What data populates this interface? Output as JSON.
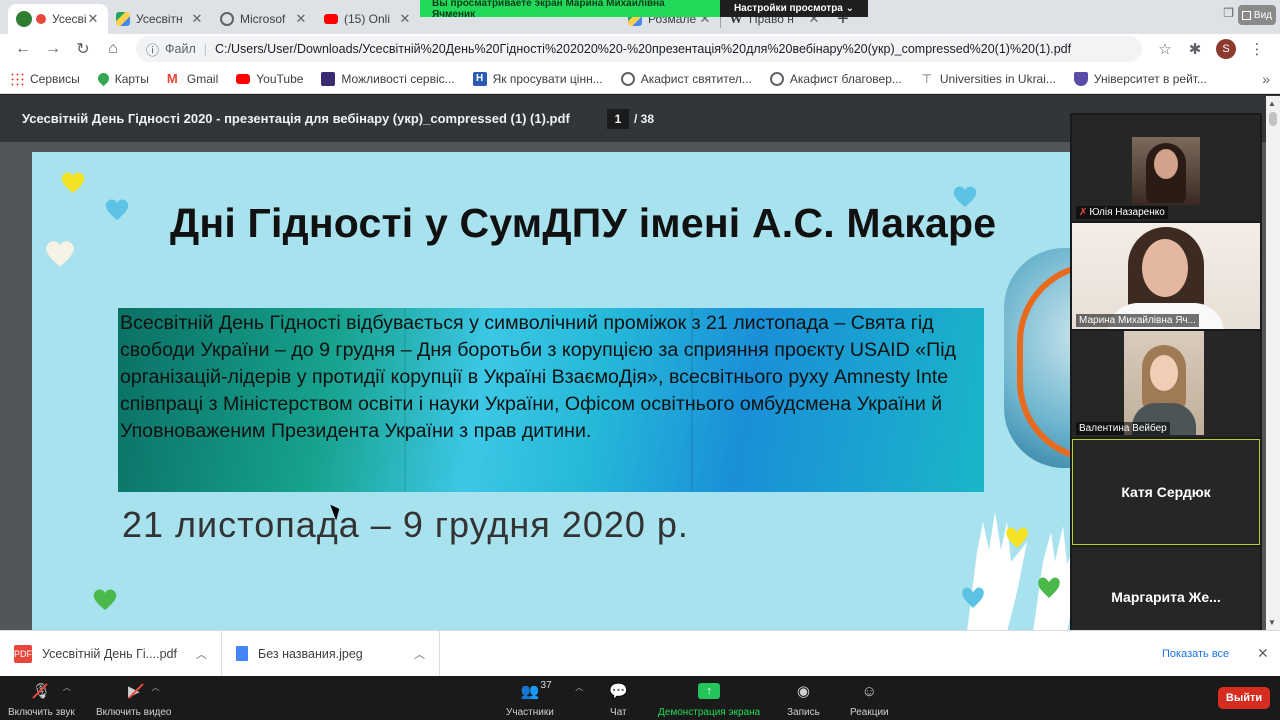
{
  "browser": {
    "tabs": [
      {
        "label": "Усесвіт",
        "icon": "pdf-icon",
        "color": "#e8453c",
        "active": true
      },
      {
        "label": "Усесвітн",
        "icon": "drive-icon",
        "color": "#1fa463"
      },
      {
        "label": "Microsof",
        "icon": "globe-icon",
        "color": "#5f6368"
      },
      {
        "label": "(15) Onli",
        "icon": "youtube-icon",
        "color": "#ff0000"
      },
      {
        "label": "",
        "icon": "youtube-icon",
        "color": "#ff0000"
      },
      {
        "label": "",
        "icon": "youtube-icon",
        "color": "#ff0000"
      },
      {
        "label": "",
        "icon": "youtube-icon",
        "color": "#ff0000"
      },
      {
        "label": "",
        "icon": "youtube-icon",
        "color": "#ff0000"
      },
      {
        "label": "Розмале",
        "icon": "drive-icon",
        "color": "#1fa463"
      },
      {
        "label": "Право н",
        "icon": "wikipedia-icon",
        "color": "#333333"
      }
    ],
    "url_scheme_label": "Файл",
    "url": "C:/Users/User/Downloads/Усесвітній%20День%20Гідності%202020%20-%20презентація%20для%20вебінару%20(укр)_compressed%20(1)%20(1).pdf",
    "profile_initial": "S",
    "bookmarks": [
      {
        "label": "Сервисы",
        "icon": "apps-icon",
        "color": "#ea4335"
      },
      {
        "label": "Карты",
        "icon": "maps-icon",
        "color": "#34a853"
      },
      {
        "label": "Gmail",
        "icon": "gmail-icon",
        "color": "#ea4335"
      },
      {
        "label": "YouTube",
        "icon": "youtube-icon",
        "color": "#ff0000"
      },
      {
        "label": "Можливості сервіс...",
        "icon": "bookmark-icon",
        "color": "#3b2b6e"
      },
      {
        "label": "Як просувати цінн...",
        "icon": "bookmark-icon",
        "color": "#2a5db0"
      },
      {
        "label": "Акафист святител...",
        "icon": "globe-icon",
        "color": "#5f6368"
      },
      {
        "label": "Акафист благовер...",
        "icon": "globe-icon",
        "color": "#5f6368"
      },
      {
        "label": "Universities in Ukrai...",
        "icon": "university-icon",
        "color": "#5f6368"
      },
      {
        "label": "Університет в рейт...",
        "icon": "shield-icon",
        "color": "#5b4aa8"
      }
    ]
  },
  "zoom_share": {
    "banner": "Вы просматриваете экран Марина Михайлівна Ячменик",
    "options": "Настройки просмотра ⌄",
    "view_button": "Вид"
  },
  "pdf": {
    "title": "Усесвітній День Гідності 2020 - презентація для вебінару (укр)_compressed (1) (1).pdf",
    "current_page": "1",
    "total_pages": "/ 38"
  },
  "slide": {
    "title": "Дні Гідності у СумДПУ імені А.С. Макаре",
    "lines": [
      "   Всесвітній День Гідності відбувається у символічний проміжок з 21 листопада – Свята гід",
      "свободи України – до 9 грудня – Дня боротьби з корупцією за сприяння проєкту USAID «Під",
      "організацій-лідерів у протидії корупції в Україні ВзаємоДія», всесвітнього руху Amnesty Inte",
      "співпраці з Міністерством освіти і науки України, Офісом освітнього омбудсмена України й",
      "Уповноваженим Президента України з прав дитини."
    ],
    "date": "21 листопада – 9 грудня 2020 р."
  },
  "participants": [
    {
      "name": "Юлія Назаренко",
      "muted": true
    },
    {
      "name": "Марина Михайлівна Яч...",
      "muted": false
    },
    {
      "name": "Валентина Вейбер",
      "muted": false
    },
    {
      "name": "Катя Сердюк",
      "speaking": true
    },
    {
      "name": "Маргарита  Же...",
      "muted": true
    }
  ],
  "downloads": {
    "items": [
      {
        "name": "Усесвітній День Гі....pdf",
        "type": "PDF"
      },
      {
        "name": "Без названия.jpeg",
        "type": "image"
      }
    ],
    "show_all": "Показать все"
  },
  "zoom_controls": {
    "mic": "Включить звук",
    "video": "Включить видео",
    "participants": "Участники",
    "participants_count": "37",
    "chat": "Чат",
    "share": "Демонстрация экрана",
    "record": "Запись",
    "reactions": "Реакции",
    "leave": "Выйти"
  }
}
